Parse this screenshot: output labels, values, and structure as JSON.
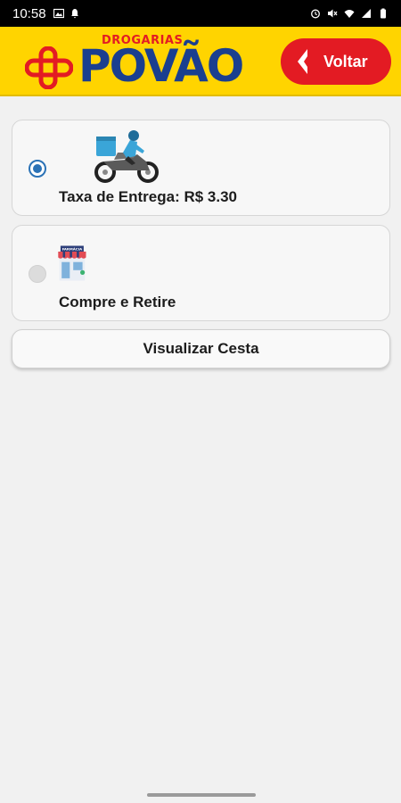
{
  "status_bar": {
    "time": "10:58",
    "left_icons": [
      "image-icon",
      "notification-icon"
    ],
    "right_icons": [
      "alarm-icon",
      "mute-icon",
      "wifi-icon",
      "signal-icon",
      "battery-icon"
    ]
  },
  "header": {
    "logo_small": "DROGARIAS",
    "logo_big": "POVÃO",
    "back_label": "Voltar",
    "colors": {
      "background": "#ffd400",
      "brand_blue": "#1a3f8f",
      "brand_red": "#e31b23"
    }
  },
  "options": [
    {
      "label": "Taxa de Entrega: R$ 3.30",
      "selected": true,
      "icon": "motorcycle-delivery-icon"
    },
    {
      "label": "Compre e Retire",
      "selected": false,
      "icon": "pharmacy-store-icon",
      "sign_text": "FARMÁCIA"
    }
  ],
  "basket_button": {
    "label": "Visualizar Cesta"
  }
}
